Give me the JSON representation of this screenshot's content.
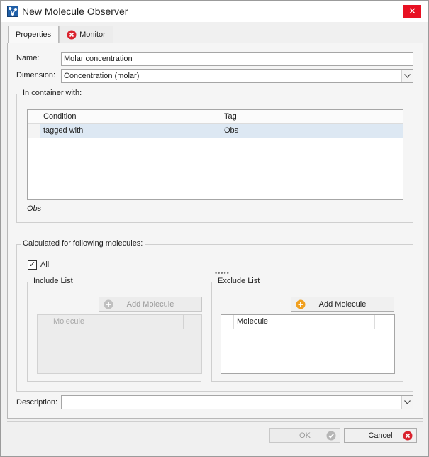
{
  "window": {
    "title": "New Molecule Observer"
  },
  "tabs": [
    {
      "label": "Properties"
    },
    {
      "label": "Monitor"
    }
  ],
  "form": {
    "name_label": "Name:",
    "name_value": "Molar concentration",
    "dimension_label": "Dimension:",
    "dimension_value": "Concentration (molar)",
    "description_label": "Description:",
    "description_value": ""
  },
  "container": {
    "caption": "In container with:",
    "columns": [
      "Condition",
      "Tag"
    ],
    "rows": [
      {
        "condition": "tagged with",
        "tag": "Obs"
      }
    ],
    "summary": "Obs"
  },
  "molecules": {
    "caption": "Calculated for following molecules:",
    "all_label": "All",
    "all_checked": "✓",
    "include": {
      "caption": "Include List",
      "add_button": "Add Molecule",
      "column": "Molecule"
    },
    "exclude": {
      "caption": "Exclude List",
      "add_button": "Add Molecule",
      "column": "Molecule"
    }
  },
  "footer": {
    "ok_label": "OK",
    "cancel_label": "Cancel"
  },
  "colors": {
    "selection_row": "#dde8f3",
    "close_red": "#e81123",
    "add_orange": "#f0a020",
    "ok_gray": "#b5b5b5"
  }
}
